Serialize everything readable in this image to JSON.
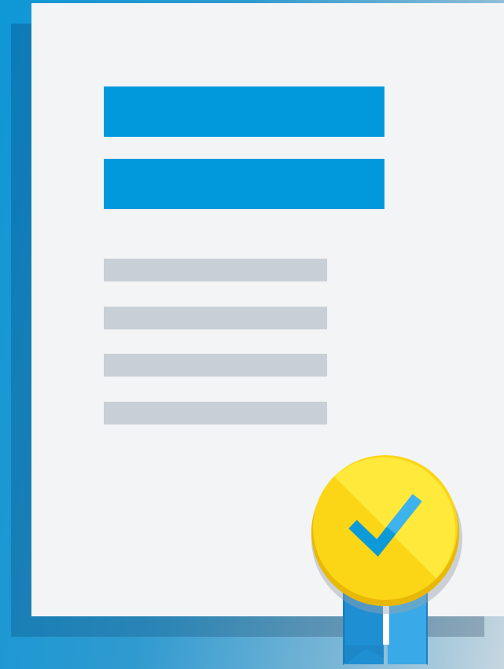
{
  "colors": {
    "heading_bar": "#0299dc",
    "text_line": "#c8cfd6",
    "sheet": "#f3f4f6",
    "seal_gold": "#fbd617",
    "seal_gold_light": "#ffe93a",
    "seal_rim": "#e9b807",
    "checkmark": "#0e9ad8",
    "ribbon": "#2395d6"
  },
  "icons": {
    "seal": "certified-seal-icon",
    "check": "checkmark-icon",
    "ribbon": "ribbon-icon"
  }
}
